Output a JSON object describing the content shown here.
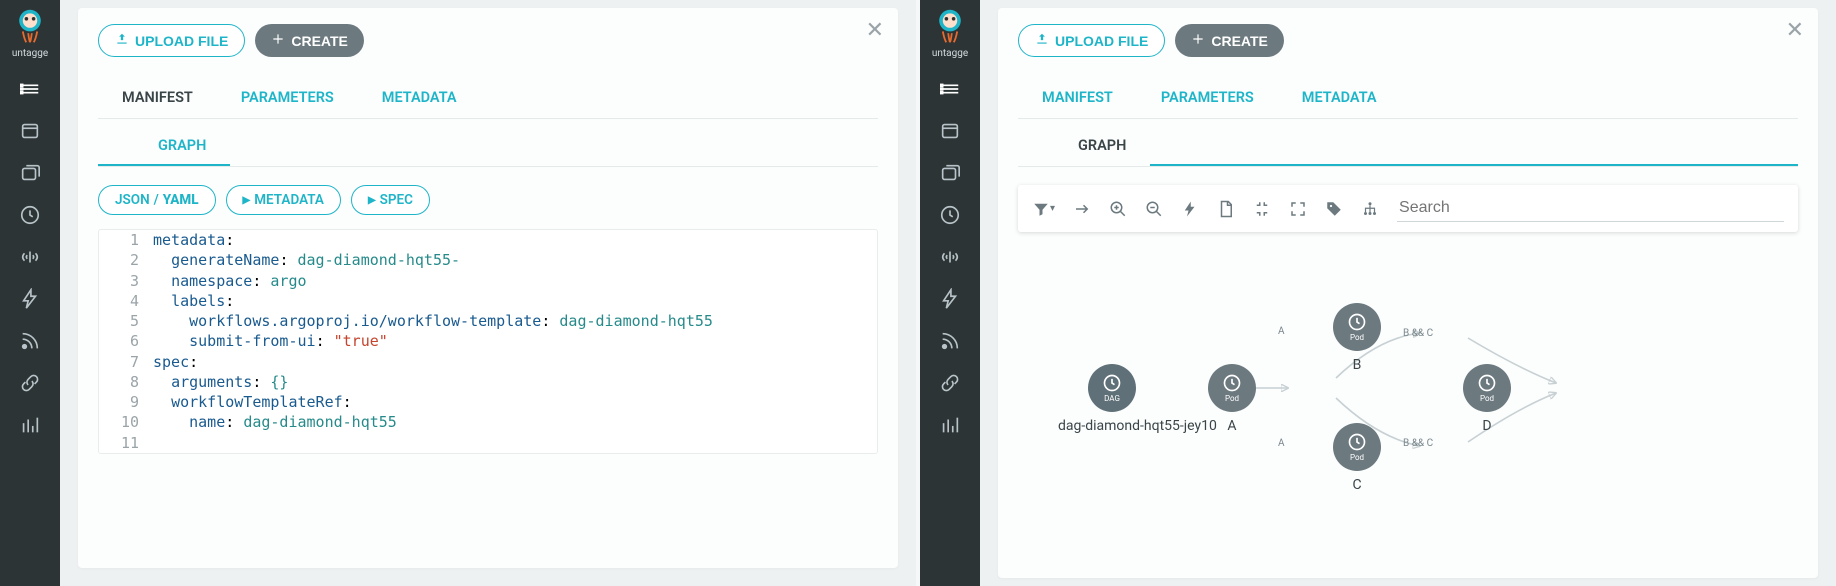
{
  "logo_sub": "untagge",
  "toolbar": {
    "upload_label": "UPLOAD FILE",
    "create_label": "CREATE"
  },
  "tabs": {
    "manifest": "MANIFEST",
    "parameters": "PARAMETERS",
    "metadata": "METADATA",
    "graph": "GRAPH"
  },
  "pills": {
    "json": "JSON",
    "yaml": "YAML",
    "metadata": "METADATA",
    "spec": "SPEC"
  },
  "code": [
    {
      "n": 1,
      "t": [
        [
          "k",
          "metadata"
        ],
        [
          "p",
          ":"
        ]
      ]
    },
    {
      "n": 2,
      "t": [
        [
          "w",
          "  "
        ],
        [
          "k",
          "generateName"
        ],
        [
          "p",
          ": "
        ],
        [
          "v",
          "dag-diamond-hqt55-"
        ]
      ]
    },
    {
      "n": 3,
      "t": [
        [
          "w",
          "  "
        ],
        [
          "k",
          "namespace"
        ],
        [
          "p",
          ": "
        ],
        [
          "v",
          "argo"
        ]
      ]
    },
    {
      "n": 4,
      "t": [
        [
          "w",
          "  "
        ],
        [
          "k",
          "labels"
        ],
        [
          "p",
          ":"
        ]
      ]
    },
    {
      "n": 5,
      "t": [
        [
          "w",
          "    "
        ],
        [
          "k",
          "workflows.argoproj.io/workflow-template"
        ],
        [
          "p",
          ": "
        ],
        [
          "v",
          "dag-diamond-hqt55"
        ]
      ]
    },
    {
      "n": 6,
      "t": [
        [
          "w",
          "    "
        ],
        [
          "k",
          "submit-from-ui"
        ],
        [
          "p",
          ": "
        ],
        [
          "s",
          "\"true\""
        ]
      ]
    },
    {
      "n": 7,
      "t": [
        [
          "k",
          "spec"
        ],
        [
          "p",
          ":"
        ]
      ]
    },
    {
      "n": 8,
      "t": [
        [
          "w",
          "  "
        ],
        [
          "k",
          "arguments"
        ],
        [
          "p",
          ": "
        ],
        [
          "v",
          "{}"
        ]
      ]
    },
    {
      "n": 9,
      "t": [
        [
          "w",
          "  "
        ],
        [
          "k",
          "workflowTemplateRef"
        ],
        [
          "p",
          ":"
        ]
      ]
    },
    {
      "n": 10,
      "t": [
        [
          "w",
          "    "
        ],
        [
          "k",
          "name"
        ],
        [
          "p",
          ": "
        ],
        [
          "v",
          "dag-diamond-hqt55"
        ]
      ]
    },
    {
      "n": 11,
      "t": []
    }
  ],
  "graph": {
    "search_placeholder": "Search",
    "root_label": "dag-diamond-hqt55-jey10",
    "root_sub": "DAG",
    "pod_sub": "Pod",
    "nodes": {
      "a": "A",
      "b": "B",
      "c": "C",
      "d": "D"
    },
    "edges": {
      "ab": "A",
      "ac": "A",
      "bd": "B && C",
      "cd": "B && C"
    }
  }
}
